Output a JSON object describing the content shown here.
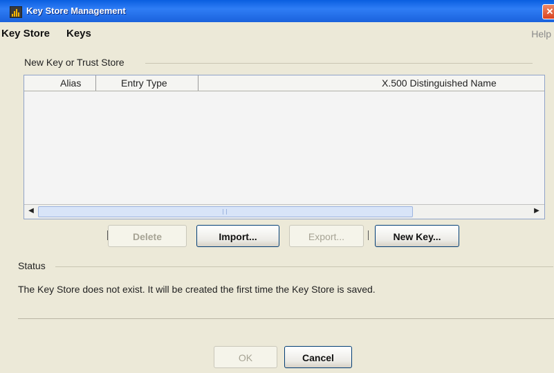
{
  "window": {
    "title": "Key Store Management",
    "close_glyph": "✕"
  },
  "menu": {
    "items": [
      "Key Store",
      "Keys"
    ],
    "help": "Help"
  },
  "keystore_panel": {
    "title": "New Key or Trust Store",
    "table": {
      "columns": [
        "Alias",
        "Entry Type",
        "X.500 Distinguished Name"
      ],
      "rows": []
    }
  },
  "buttons": {
    "delete": "Delete",
    "import": "Import...",
    "export": "Export...",
    "new_key": "New Key...",
    "ok": "OK",
    "cancel": "Cancel"
  },
  "status": {
    "title": "Status",
    "message": "The Key Store does not exist.  It will be created the first time the Key Store is saved."
  },
  "icons": {
    "scroll_left": "◀",
    "scroll_right": "▶"
  }
}
